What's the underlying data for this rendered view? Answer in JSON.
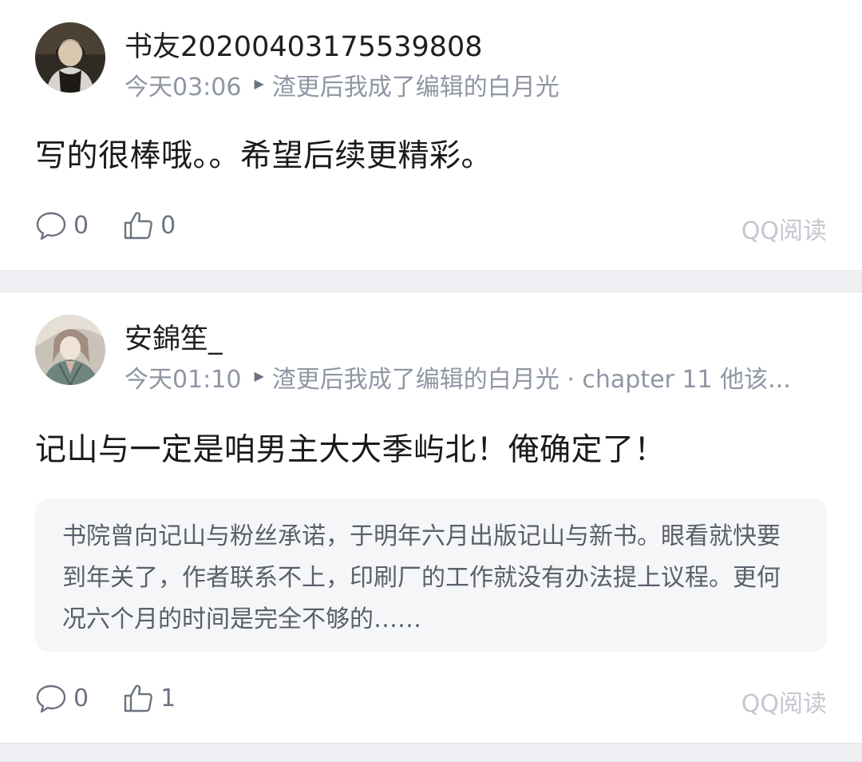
{
  "comments": [
    {
      "username": "书友20200403175539808",
      "time": "今天03:06",
      "book": "渣更后我成了编辑的白月光",
      "content": "写的很棒哦。。希望后续更精彩。",
      "reply_count": "0",
      "like_count": "0",
      "source": "QQ阅读"
    },
    {
      "username": "安錦笙_",
      "time": "今天01:10",
      "book": "渣更后我成了编辑的白月光 · chapter 11 他该...",
      "content": "记山与一定是咱男主大大季屿北！俺确定了！",
      "quote": "书院曾向记山与粉丝承诺，于明年六月出版记山与新书。眼看就快要到年关了，作者联系不上，印刷厂的工作就没有办法提上议程。更何况六个月的时间是完全不够的……",
      "reply_count": "0",
      "like_count": "1",
      "source": "QQ阅读"
    }
  ],
  "icons": {
    "reply": "comment-bubble-icon",
    "like": "thumbs-up-icon",
    "book_link": "triangle-right-icon"
  },
  "colors": {
    "background": "#ffffff",
    "divider": "#eef0f4",
    "meta_text": "#8f96a3",
    "quote_bg": "#f5f6f8",
    "source_text": "#c3c7ce"
  }
}
